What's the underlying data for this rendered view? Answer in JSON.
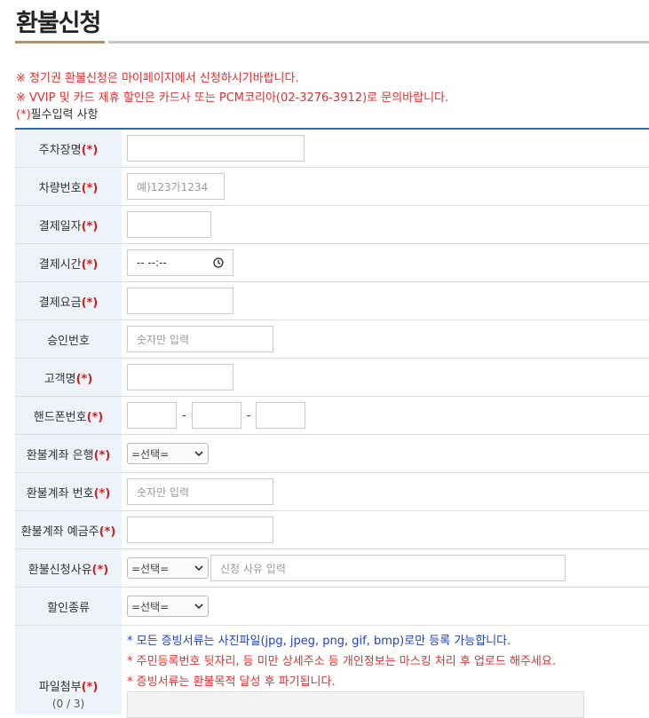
{
  "page": {
    "title": "환불신청"
  },
  "notices": [
    "※ 정기권 환불신청은 마이페이지에서 신청하시기바랍니다.",
    "※ VVIP 및 카드 제휴 할인은 카드사 또는 PCM코리아(02-3276-3912)로 문의바랍니다."
  ],
  "required_note": {
    "mark": "(*)",
    "text": "필수입력 사항"
  },
  "required_mark": "(*)",
  "form": {
    "parking_lot": {
      "label": "주차장명",
      "value": ""
    },
    "car_number": {
      "label": "차량번호",
      "placeholder": "예)123가1234"
    },
    "pay_date": {
      "label": "결제일자",
      "value": ""
    },
    "pay_time": {
      "label": "결제시간",
      "value": "-- --:--"
    },
    "pay_amount": {
      "label": "결제요금",
      "value": ""
    },
    "approval_no": {
      "label": "승인번호",
      "placeholder": "숫자만 입력"
    },
    "customer_name": {
      "label": "고객명",
      "value": ""
    },
    "phone": {
      "label": "핸드폰번호",
      "separator": "-"
    },
    "refund_bank": {
      "label": "환불계좌 은행",
      "selected": "=선택="
    },
    "refund_account": {
      "label": "환불계좌 번호",
      "placeholder": "숫자만 입력"
    },
    "account_holder": {
      "label": "환불계좌 예금주",
      "value": ""
    },
    "refund_reason": {
      "label": "환불신청사유",
      "selected": "=선택=",
      "placeholder": "신청 사유 입력"
    },
    "discount_type": {
      "label": "할인종류",
      "selected": "=선택="
    },
    "attachment": {
      "label": "파일첨부",
      "count": "(0 / 3)",
      "notes": [
        "* 모든 증빙서류는 사진파일(jpg, jpeg, png, gif, bmp)로만 등록 가능합니다.",
        "* 주민등록번호 뒷자리, 등 미만 상세주소 등 개인정보는 마스킹 처리 후 업로드 해주세요.",
        "* 증빙서류는 환불목적 달성 후 파기됩니다."
      ]
    }
  },
  "colors": {
    "accent_blue": "#2f6ab2",
    "required_red": "#d01e1e",
    "label_bg": "#eef3fa"
  }
}
